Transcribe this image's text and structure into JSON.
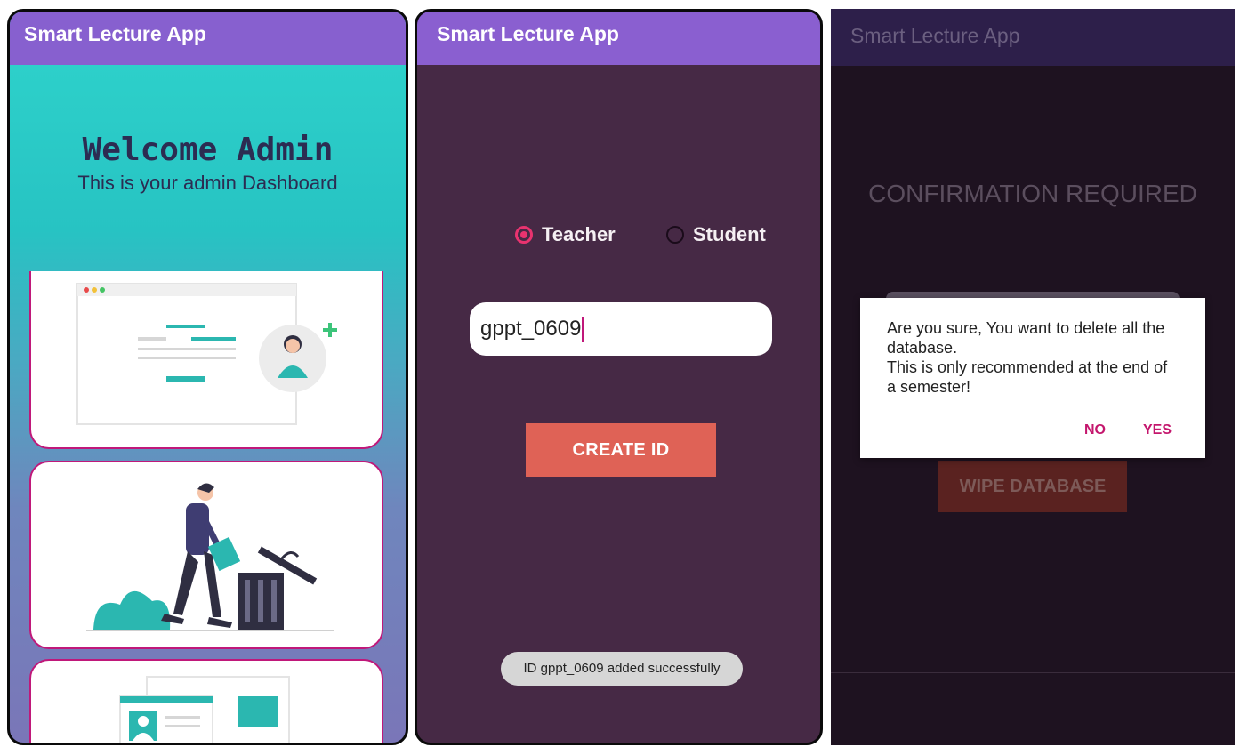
{
  "app_title": "Smart Lecture App",
  "admin_screen": {
    "welcome": "Welcome Admin",
    "subtitle": "This is your admin Dashboard"
  },
  "create_screen": {
    "radio_teacher": "Teacher",
    "radio_student": "Student",
    "selected_role": "Teacher",
    "id_value": "gppt_0609",
    "create_label": "CREATE ID",
    "toast": "ID gppt_0609 added successfully"
  },
  "wipe_screen": {
    "heading": "CONFIRMATION REQUIRED",
    "dialog_line1": "Are you sure, You want to delete all the database.",
    "dialog_line2": "This is only recommended at the end of a semester!",
    "no_label": "NO",
    "yes_label": "YES",
    "wipe_label": "WIPE DATABASE"
  },
  "colors": {
    "accent": "#8a5fd0",
    "pink": "#c4166d",
    "create_button": "#df6256",
    "teal": "#2fd4cc"
  }
}
